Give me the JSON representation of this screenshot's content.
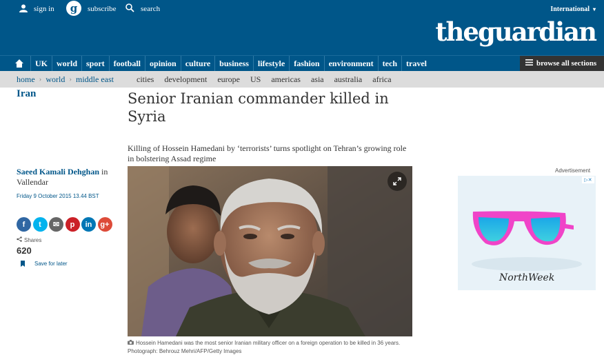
{
  "topbar": {
    "signin": "sign in",
    "subscribe": "subscribe",
    "search": "search",
    "edition": "International"
  },
  "logo": {
    "the": "the",
    "guardian": "guardian"
  },
  "nav": {
    "items": [
      "UK",
      "world",
      "sport",
      "football",
      "opinion",
      "culture",
      "business",
      "lifestyle",
      "fashion",
      "environment",
      "tech",
      "travel"
    ],
    "browse": "browse all sections"
  },
  "breadcrumb": [
    "home",
    "world",
    "middle east"
  ],
  "sublinks": [
    "cities",
    "development",
    "europe",
    "US",
    "americas",
    "asia",
    "australia",
    "africa"
  ],
  "section": "Iran",
  "article": {
    "headline": "Senior Iranian commander killed in Syria",
    "standfirst": "Killing of Hossein Hamedani by ‘terrorists’ turns spotlight on Tehran’s growing role in bolstering Assad regime",
    "author": "Saeed Kamali Dehghan",
    "in": "in",
    "location": "Vallendar",
    "date": "Friday 9 October 2015 13.44 BST",
    "caption_line1": "Hossein Hamedani was the most senior Iranian military officer on a foreign operation to be killed in 36 years.",
    "caption_line2": "Photograph: Behrouz Mehri/AFP/Getty Images"
  },
  "share": {
    "buttons": [
      {
        "name": "facebook",
        "glyph": "f",
        "color": "#3067a3"
      },
      {
        "name": "twitter",
        "glyph": "t",
        "color": "#03b3ee"
      },
      {
        "name": "email",
        "glyph": "✉",
        "color": "#666666"
      },
      {
        "name": "pinterest",
        "glyph": "p",
        "color": "#cb2027"
      },
      {
        "name": "linkedin",
        "glyph": "in",
        "color": "#0077b5"
      },
      {
        "name": "googleplus",
        "glyph": "g+",
        "color": "#dd4b39"
      }
    ],
    "label": "Shares",
    "count": "620",
    "save": "Save for later"
  },
  "ad": {
    "label": "Advertisement",
    "brand": "NorthWeek"
  },
  "colors": {
    "brand_blue": "#005689",
    "subnav_bg": "#dcdcdc",
    "browse_bg": "#333333"
  }
}
